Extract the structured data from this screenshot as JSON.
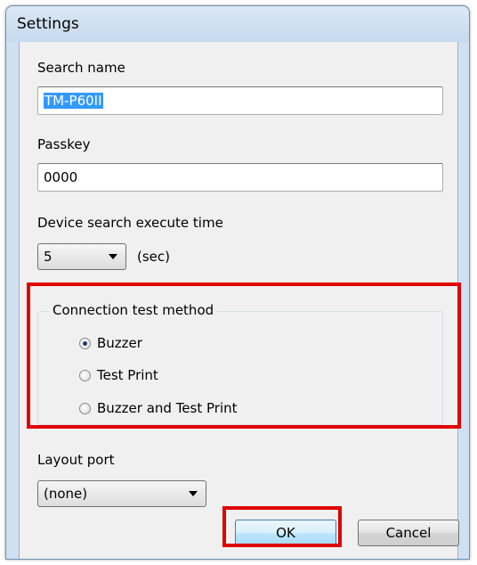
{
  "window": {
    "title": "Settings"
  },
  "search_name": {
    "label": "Search name",
    "value": "TM-P60II"
  },
  "passkey": {
    "label": "Passkey",
    "value": "0000"
  },
  "device_search": {
    "label": "Device search execute time",
    "selected": "5",
    "unit": "(sec)"
  },
  "connection_test": {
    "title": "Connection test method",
    "options": [
      {
        "label": "Buzzer",
        "checked": true
      },
      {
        "label": "Test Print",
        "checked": false
      },
      {
        "label": "Buzzer and Test Print",
        "checked": false
      }
    ]
  },
  "layout_port": {
    "label": "Layout port",
    "selected": "(none)"
  },
  "buttons": {
    "ok": "OK",
    "cancel": "Cancel"
  },
  "colors": {
    "highlight": "#e00000",
    "text_selection": "#3399ff",
    "title_bar": "#c6d9ee"
  }
}
